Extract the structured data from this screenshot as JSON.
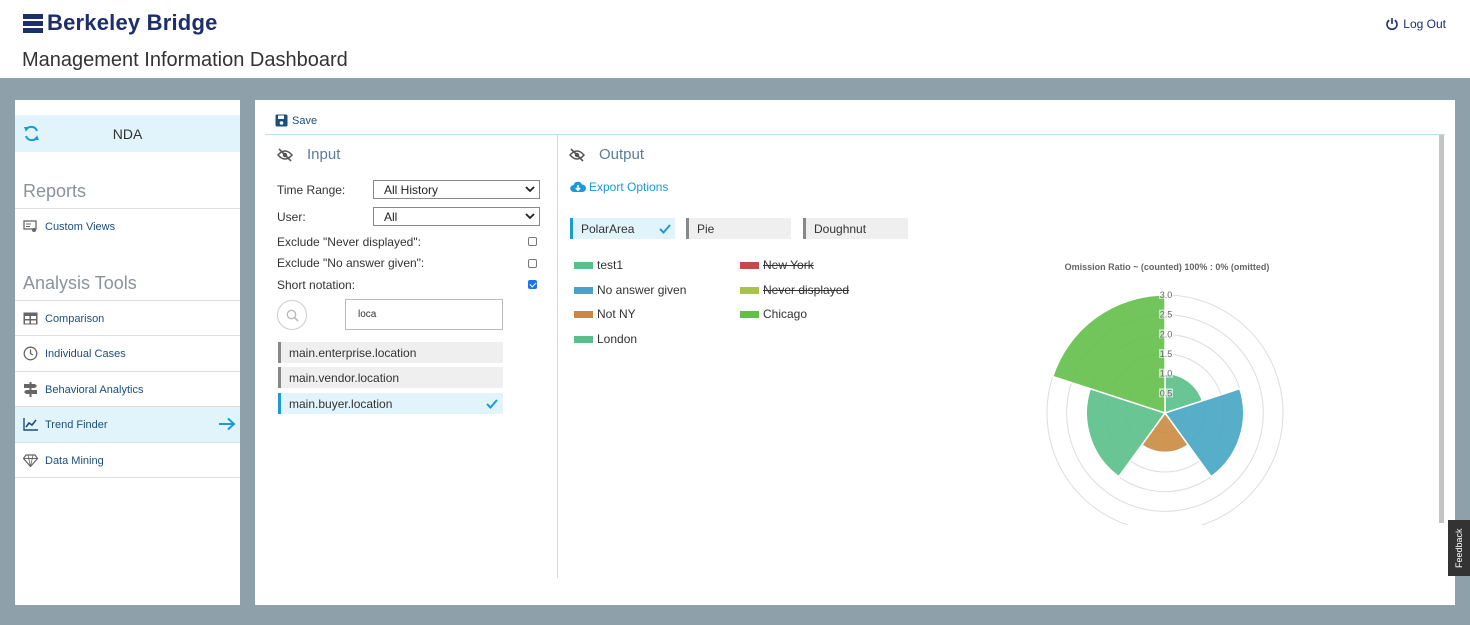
{
  "header": {
    "logo_text": "Berkeley Bridge",
    "title": "Management Information Dashboard",
    "logout_label": "Log Out"
  },
  "sidebar": {
    "project": "NDA",
    "reports_title": "Reports",
    "reports": [
      {
        "label": "Custom Views",
        "icon": "custom-views-icon"
      }
    ],
    "analysis_title": "Analysis Tools",
    "tools": [
      {
        "label": "Comparison",
        "icon": "table-icon"
      },
      {
        "label": "Individual Cases",
        "icon": "clock-icon"
      },
      {
        "label": "Behavioral Analytics",
        "icon": "signpost-icon"
      },
      {
        "label": "Trend Finder",
        "icon": "trend-icon",
        "active": true
      },
      {
        "label": "Data Mining",
        "icon": "diamond-icon"
      }
    ]
  },
  "main": {
    "save_label": "Save",
    "input": {
      "title": "Input",
      "time_range_label": "Time Range:",
      "time_range_value": "All History",
      "user_label": "User:",
      "user_value": "All",
      "exclude_never_label": "Exclude \"Never displayed\":",
      "exclude_never": false,
      "exclude_noanswer_label": "Exclude \"No answer given\":",
      "exclude_noanswer": false,
      "short_notation_label": "Short notation:",
      "short_notation": true,
      "search_value": "loca",
      "results": [
        {
          "label": "main.enterprise.location",
          "selected": false
        },
        {
          "label": "main.vendor.location",
          "selected": false
        },
        {
          "label": "main.buyer.location",
          "selected": true
        }
      ]
    },
    "output": {
      "title": "Output",
      "export_label": "Export Options",
      "chart_types": [
        {
          "label": "PolarArea",
          "selected": true
        },
        {
          "label": "Pie",
          "selected": false
        },
        {
          "label": "Doughnut",
          "selected": false
        }
      ],
      "legend": [
        {
          "label": "test1",
          "color": "#5abf8a",
          "hidden": false
        },
        {
          "label": "No answer given",
          "color": "#45a5c2",
          "hidden": false
        },
        {
          "label": "Not NY",
          "color": "#c98a40",
          "hidden": false
        },
        {
          "label": "London",
          "color": "#5abf8a",
          "hidden": false
        },
        {
          "label": "New York",
          "color": "#c24a4a",
          "hidden": true
        },
        {
          "label": "Never displayed",
          "color": "#a8c24a",
          "hidden": true
        },
        {
          "label": "Chicago",
          "color": "#63bf48",
          "hidden": false
        }
      ]
    }
  },
  "chart_data": {
    "type": "polarArea",
    "title": "Omission Ratio ~ (counted) 100% : 0% (omitted)",
    "categories": [
      "test1",
      "No answer given",
      "Not NY",
      "London",
      "Chicago"
    ],
    "values": [
      1.0,
      2.0,
      1.0,
      2.0,
      3.0
    ],
    "colors": [
      "#5abf8a",
      "#45a5c2",
      "#c98a40",
      "#5abf8a",
      "#63bf48"
    ],
    "r_ticks": [
      "0.5",
      "1.0",
      "1.5",
      "2.0",
      "2.5",
      "3.0"
    ],
    "rlim": [
      0,
      3.0
    ]
  },
  "feedback_label": "Feedback"
}
